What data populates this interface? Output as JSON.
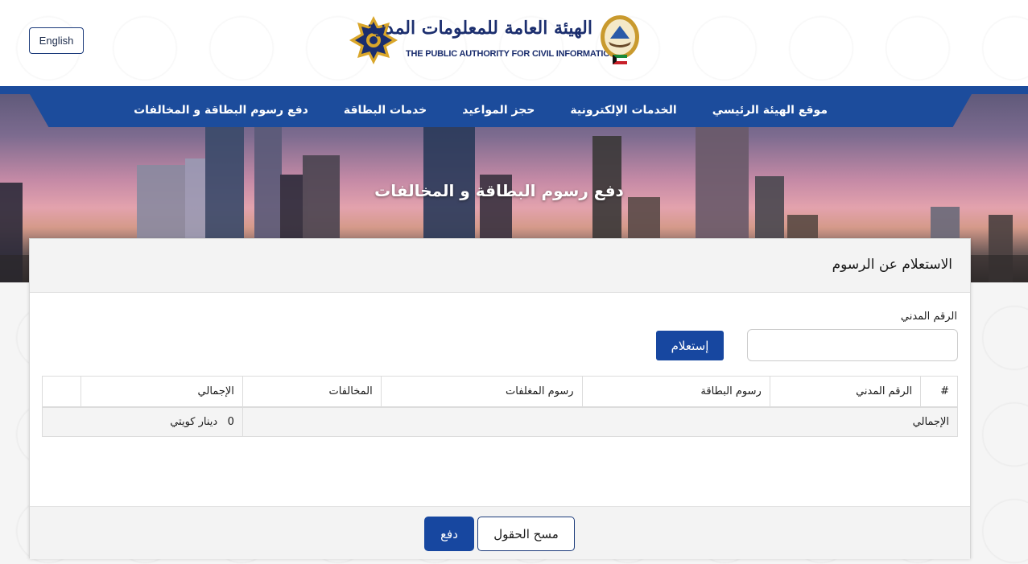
{
  "header": {
    "language_button": "English",
    "logo_arabic": "الهيئة العامة للمعلومات المدنية",
    "logo_english": "THE PUBLIC AUTHORITY FOR CIVIL INFORMATION"
  },
  "nav": {
    "items": [
      {
        "label": "موقع الهيئة الرئيسي"
      },
      {
        "label": "الخدمات الإلكترونية"
      },
      {
        "label": "حجز المواعيد"
      },
      {
        "label": "خدمات البطاقة"
      },
      {
        "label": "دفع رسوم البطاقة و المخالفات"
      }
    ]
  },
  "hero": {
    "title": "دفع رسوم البطاقة و المخالفات"
  },
  "panel": {
    "title": "الاستعلام عن الرسوم",
    "civil_id_label": "الرقم المدني",
    "civil_id_value": "",
    "query_button": "إستعلام"
  },
  "table": {
    "headers": [
      "#",
      "الرقم المدني",
      "رسوم البطاقة",
      "رسوم المغلفات",
      "المخالفات",
      "الإجمالي",
      ""
    ],
    "total_row": {
      "label": "الإجمالي",
      "amount": "0",
      "currency": "دينار كويتي"
    }
  },
  "footer": {
    "pay_button": "دفع",
    "clear_button": "مسح الحقول"
  },
  "colors": {
    "primary": "#1747a0",
    "nav": "#1c4c9c",
    "logo_text": "#1b2e6e"
  }
}
